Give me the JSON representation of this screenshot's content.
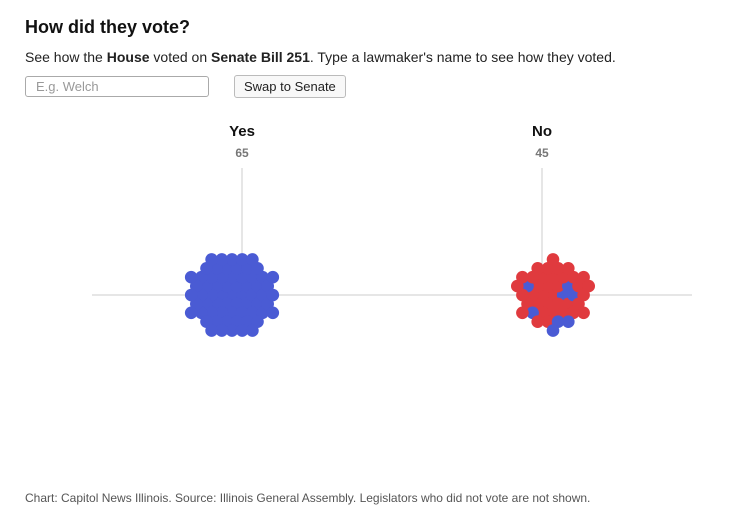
{
  "header": {
    "title": "How did they vote?",
    "subtitle": {
      "part1": "See how the ",
      "chamber": "House",
      "part2": " voted on ",
      "bill": "Senate Bill 251",
      "part3": ". Type a lawmaker's name to see how they voted."
    }
  },
  "controls": {
    "search_placeholder": "E.g. Welch",
    "swap_label": "Swap to Senate"
  },
  "colors": {
    "democrat": "#4a5bd4",
    "republican": "#e03a3e",
    "axis": "#cccccc",
    "count": "#777777"
  },
  "chart_data": {
    "type": "scatter",
    "subtype": "beeswarm",
    "groups": [
      {
        "label": "Yes",
        "count": 65,
        "blue": 65,
        "red": 0
      },
      {
        "label": "No",
        "count": 45,
        "blue": 8,
        "red": 37
      }
    ]
  },
  "footer": "Chart: Capitol News Illinois. Source: Illinois General Assembly. Legislators who did not vote are not shown."
}
